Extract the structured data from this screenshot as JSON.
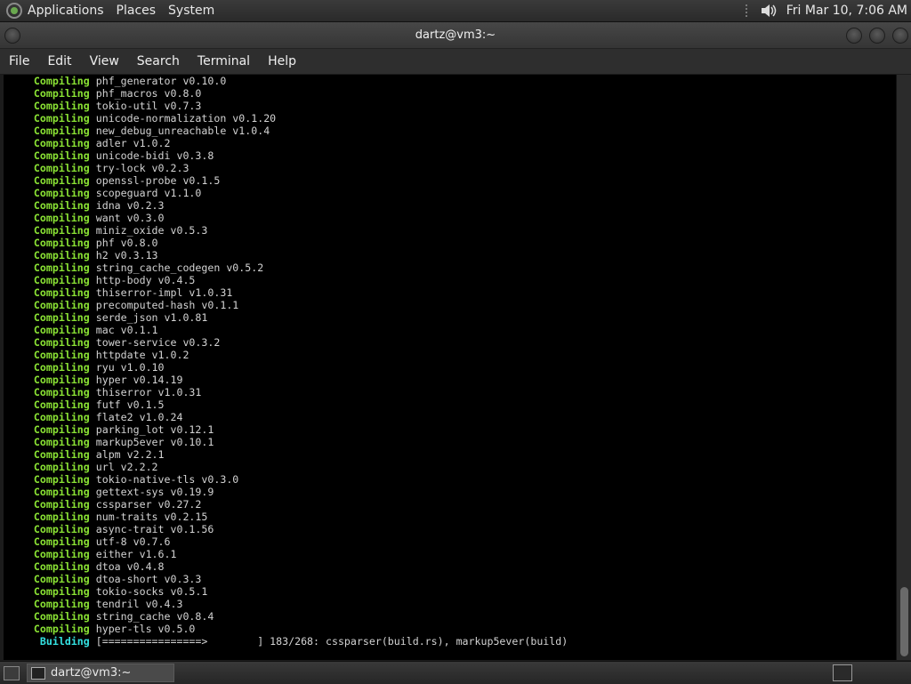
{
  "panel": {
    "menus": [
      "Applications",
      "Places",
      "System"
    ],
    "clock": "Fri Mar 10,  7:06 AM"
  },
  "window": {
    "title": "dartz@vm3:~",
    "menubar": [
      "File",
      "Edit",
      "View",
      "Search",
      "Terminal",
      "Help"
    ]
  },
  "terminal": {
    "compile_keyword": "Compiling",
    "lines": [
      "phf_generator v0.10.0",
      "phf_macros v0.8.0",
      "tokio-util v0.7.3",
      "unicode-normalization v0.1.20",
      "new_debug_unreachable v1.0.4",
      "adler v1.0.2",
      "unicode-bidi v0.3.8",
      "try-lock v0.2.3",
      "openssl-probe v0.1.5",
      "scopeguard v1.1.0",
      "idna v0.2.3",
      "want v0.3.0",
      "miniz_oxide v0.5.3",
      "phf v0.8.0",
      "h2 v0.3.13",
      "string_cache_codegen v0.5.2",
      "http-body v0.4.5",
      "thiserror-impl v1.0.31",
      "precomputed-hash v0.1.1",
      "serde_json v1.0.81",
      "mac v0.1.1",
      "tower-service v0.3.2",
      "httpdate v1.0.2",
      "ryu v1.0.10",
      "hyper v0.14.19",
      "thiserror v1.0.31",
      "futf v0.1.5",
      "flate2 v1.0.24",
      "parking_lot v0.12.1",
      "markup5ever v0.10.1",
      "alpm v2.2.1",
      "url v2.2.2",
      "tokio-native-tls v0.3.0",
      "gettext-sys v0.19.9",
      "cssparser v0.27.2",
      "num-traits v0.2.15",
      "async-trait v0.1.56",
      "utf-8 v0.7.6",
      "either v1.6.1",
      "dtoa v0.4.8",
      "dtoa-short v0.3.3",
      "tokio-socks v0.5.1",
      "tendril v0.4.3",
      "string_cache v0.8.4",
      "hyper-tls v0.5.0"
    ],
    "building_keyword": "Building",
    "building_line": "[================>        ] 183/268: cssparser(build.rs), markup5ever(build)"
  },
  "taskbar": {
    "task_label": "dartz@vm3:~"
  }
}
